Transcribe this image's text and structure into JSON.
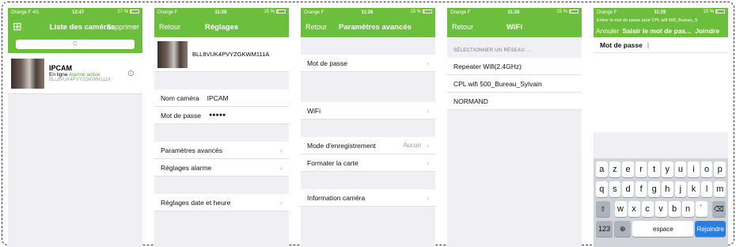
{
  "status": {
    "carrier": "Orange F",
    "network1": "4G",
    "time1": "12:47",
    "battery1": "17 %",
    "time2": "11:28",
    "battery2": "15 %",
    "time5": "11:29"
  },
  "screen1": {
    "title": "Liste des caméras",
    "right": "Supprimer",
    "search_placeholder": "Q",
    "cam_name": "IPCAM",
    "cam_status_prefix": "En ligne",
    "cam_alarm": "Alarme active",
    "cam_id": "BLL8VUK4PVYZGKWM111A"
  },
  "screen2": {
    "back": "Retour",
    "title": "Réglages",
    "cam_id": "BLL8VUK4PVYZGKWM111A",
    "name_label": "Nom caméra",
    "name_value": "IPCAM",
    "pwd_label": "Mot de passe",
    "pwd_value": "●●●●●",
    "advanced": "Paramètres avancés",
    "alarm": "Réglages alarme",
    "datetime": "Réglages date et heure"
  },
  "screen3": {
    "back": "Retour",
    "title": "Paramètres avancés",
    "password": "Mot de passe",
    "wifi": "WiFi",
    "record_mode": "Mode d'enregistrement",
    "record_value": "Aucun",
    "format": "Formater la carte",
    "info": "Information caméra"
  },
  "screen4": {
    "back": "Retour",
    "title": "WiFi",
    "section": "SÉLECTIONNER UN RÉSEAU ...",
    "networks": [
      "Repeater Wifi(2.4GHz)",
      "CPL wifi 500_Bureau_Sylvain",
      "NORMAND"
    ]
  },
  "screen5": {
    "prompt": "Entrer le mot de passe pour CPL wifi 500_Bureau_S",
    "cancel": "Annuler",
    "title": "Saisir le mot de pas...",
    "join": "Joindre",
    "field_label": "Mot de passe",
    "keys_row1": [
      "a",
      "z",
      "e",
      "r",
      "t",
      "y",
      "u",
      "i",
      "o",
      "p"
    ],
    "keys_row2": [
      "q",
      "s",
      "d",
      "f",
      "g",
      "h",
      "j",
      "k",
      "l",
      "m"
    ],
    "keys_row3": [
      "w",
      "x",
      "c",
      "v",
      "b",
      "n",
      "´"
    ],
    "key_123": "123",
    "key_space": "espace",
    "key_join": "Rejoindre"
  }
}
